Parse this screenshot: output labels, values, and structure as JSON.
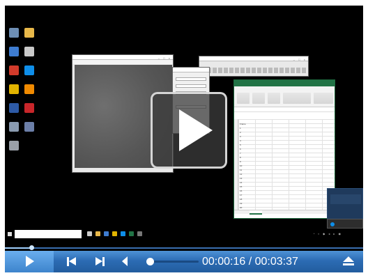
{
  "player": {
    "elapsed": "00:00:16",
    "duration": "00:03:37",
    "separator": " / ",
    "progress_fraction": 0.074,
    "volume_fraction": 0.0,
    "colors": {
      "bar": "#2c6cb4",
      "accent": "#6aaeee"
    }
  },
  "desktop": {
    "icons": [
      {
        "name": "recycle-bin-icon",
        "color": "#6e8fb5"
      },
      {
        "name": "folder-icon",
        "color": "#e8b84a"
      },
      {
        "name": "network-icon",
        "color": "#3e7cd0"
      },
      {
        "name": "search-tool-icon",
        "color": "#c9c9c9"
      },
      {
        "name": "pdf-icon",
        "color": "#d23b2b"
      },
      {
        "name": "teamviewer-icon",
        "color": "#0e8ee9"
      },
      {
        "name": "chrome-icon",
        "color": "#e2b400"
      },
      {
        "name": "vlc-icon",
        "color": "#f08a00"
      },
      {
        "name": "app-icon",
        "color": "#2d5aa6"
      },
      {
        "name": "acrobat-icon",
        "color": "#c8262a"
      },
      {
        "name": "tool-icon",
        "color": "#8a9bb0"
      },
      {
        "name": "shortcut-icon",
        "color": "#6c7fa8"
      },
      {
        "name": "settings-icon",
        "color": "#9aa0a8"
      }
    ]
  },
  "excel": {
    "colA": [
      "Frame",
      "1",
      "2",
      "3",
      "4",
      "5",
      "6",
      "7",
      "8",
      "9",
      "10",
      "11",
      "12",
      "13",
      "14",
      "15",
      "16",
      "17",
      "18",
      "19",
      "20"
    ]
  }
}
